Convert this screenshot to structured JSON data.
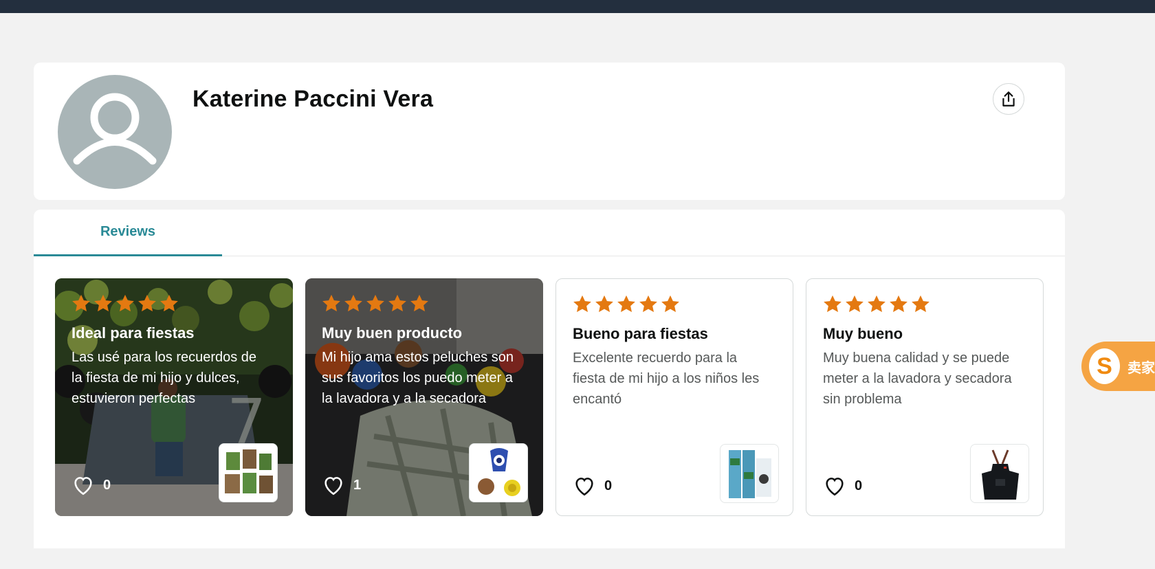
{
  "profile": {
    "name": "Katerine Paccini Vera"
  },
  "tabs": [
    {
      "label": "Reviews"
    }
  ],
  "colors": {
    "star": "#e47911",
    "accent": "#2a8a96",
    "topbar": "#232f3e"
  },
  "reviews": [
    {
      "rating": 5,
      "title": "Ideal para fiestas",
      "body": "Las usé para los recuerdos de la fiesta de mi hijo y dulces, estuvieron perfectas",
      "likes": "0",
      "has_photo": true,
      "product_icon": "party-bags-thumbnail"
    },
    {
      "rating": 5,
      "title": "Muy buen producto",
      "body": "Mi hijo ama estos peluches son sus favoritos los puedo meter a la lavadora y a la secadora",
      "likes": "1",
      "has_photo": true,
      "product_icon": "plush-toys-thumbnail"
    },
    {
      "rating": 5,
      "title": "Bueno para fiestas",
      "body": "Excelente recuerdo para la fiesta de mi hijo a los niños les encantó",
      "likes": "0",
      "has_photo": false,
      "product_icon": "party-favor-packs-thumbnail"
    },
    {
      "rating": 5,
      "title": "Muy bueno",
      "body": "Muy buena calidad y se puede meter a la lavadora y secadora sin problema",
      "likes": "0",
      "has_photo": false,
      "product_icon": "apron-thumbnail"
    }
  ],
  "extension": {
    "label": "卖家"
  }
}
